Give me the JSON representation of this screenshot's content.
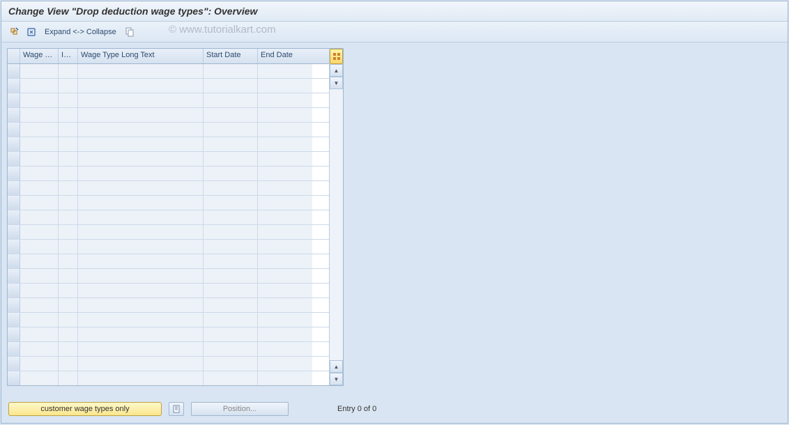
{
  "title": "Change View \"Drop deduction wage types\": Overview",
  "toolbar": {
    "expand_collapse_label": "Expand <-> Collapse"
  },
  "watermark": "© www.tutorialkart.com",
  "grid": {
    "columns": {
      "wage_ty": "Wage Ty...",
      "inf": "Inf...",
      "wage_long": "Wage Type Long Text",
      "start_date": "Start Date",
      "end_date": "End Date"
    },
    "row_count": 22
  },
  "bottom": {
    "customer_btn": "customer wage types only",
    "position_btn": "Position...",
    "entry_text": "Entry 0 of 0"
  }
}
